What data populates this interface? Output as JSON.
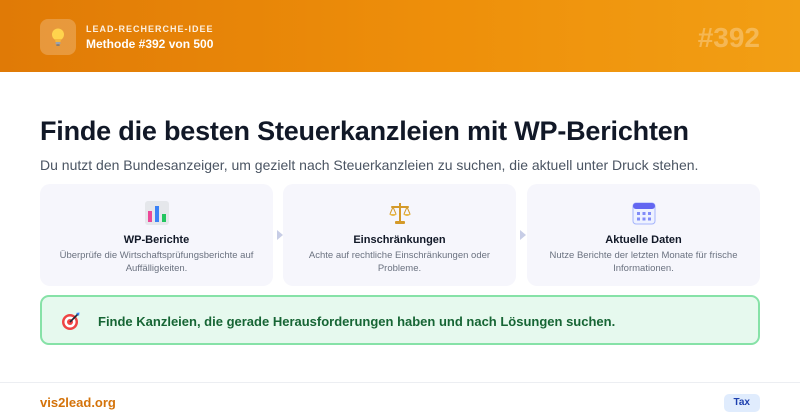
{
  "header": {
    "eyebrow": "LEAD-RECHERCHE-IDEE",
    "method_label": "Methode #392 von 500",
    "big_number": "#392",
    "logo_icon": "lightbulb-icon",
    "gradient_colors": [
      "#e07a06",
      "#f29f14"
    ]
  },
  "main": {
    "title": "Finde die besten Steuerkanzleien mit WP-Berichten",
    "subtitle": "Du nutzt den Bundesanzeiger, um gezielt nach Steuerkanzleien zu suchen, die aktuell unter Druck stehen.",
    "cards": [
      {
        "icon": "bar-chart-icon",
        "title": "WP-Berichte",
        "description": "Überprüfe die Wirtschaftsprüfungsberichte auf Auffälligkeiten."
      },
      {
        "icon": "scales-icon",
        "title": "Einschränkungen",
        "description": "Achte auf rechtliche Einschränkungen oder Probleme."
      },
      {
        "icon": "calendar-icon",
        "title": "Aktuelle Daten",
        "description": "Nutze Berichte der letzten Monate für frische Informationen."
      }
    ],
    "callout": {
      "icon": "target-icon",
      "text": "Finde Kanzleien, die gerade Herausforderungen haben und nach Lösungen suchen.",
      "color": "#166534"
    }
  },
  "footer": {
    "brand": "vis2lead.org",
    "tag": "Tax",
    "brand_color": "#d4730a"
  }
}
